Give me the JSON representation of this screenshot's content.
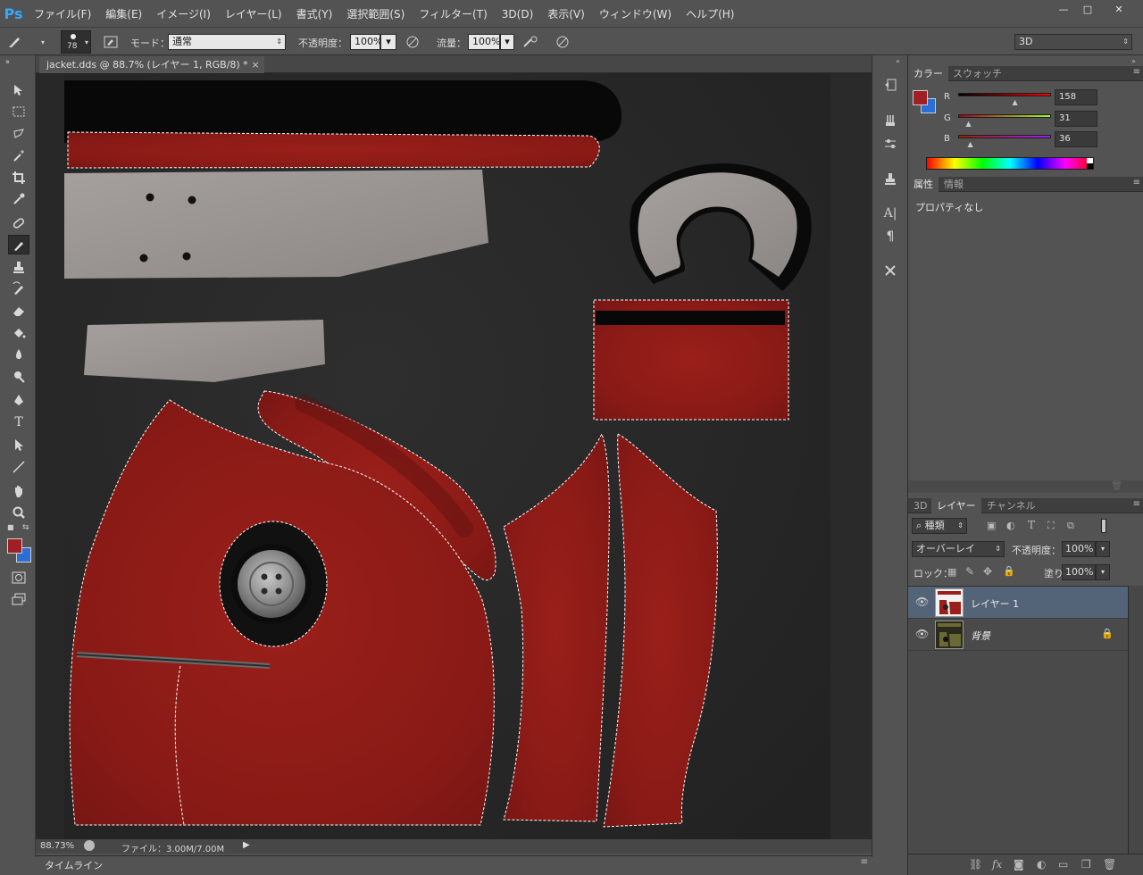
{
  "app": {
    "logo": "Ps"
  },
  "menu": [
    "ファイル(F)",
    "編集(E)",
    "イメージ(I)",
    "レイヤー(L)",
    "書式(Y)",
    "選択範囲(S)",
    "フィルター(T)",
    "3D(D)",
    "表示(V)",
    "ウィンドウ(W)",
    "ヘルプ(H)"
  ],
  "window_controls": {
    "minimize": "—",
    "maximize": "□",
    "close": "✕"
  },
  "options": {
    "brush_size": "78",
    "mode_label": "モード：",
    "mode_value": "通常",
    "opacity_label": "不透明度：",
    "opacity_value": "100%",
    "flow_label": "流量：",
    "flow_value": "100%",
    "workspace": "3D"
  },
  "document": {
    "tab_title": "jacket.dds @ 88.7% (レイヤー 1, RGB/8) *",
    "close": "×",
    "zoom": "88.73%",
    "file_info": "ファイル：3.00M/7.00M"
  },
  "timeline": {
    "label": "タイムライン"
  },
  "color_panel": {
    "tabs": [
      "カラー",
      "スウォッチ"
    ],
    "channels": [
      {
        "name": "R",
        "value": "158",
        "level": 0.62
      },
      {
        "name": "G",
        "value": "31",
        "level": 0.12
      },
      {
        "name": "B",
        "value": "36",
        "level": 0.14
      }
    ],
    "foreground": "#9e1f24",
    "background": "#2a6fd6"
  },
  "properties_panel": {
    "tabs": [
      "属性",
      "情報"
    ],
    "empty_text": "プロパティなし"
  },
  "layers_panel": {
    "tabs": [
      "3D",
      "レイヤー",
      "チャンネル"
    ],
    "filter_kind": "種類",
    "blend_mode": "オーバーレイ",
    "opacity_label": "不透明度：",
    "opacity_value": "100%",
    "lock_label": "ロック：",
    "fill_label": "塗り：",
    "fill_value": "100%",
    "layers": [
      {
        "name": "レイヤー 1",
        "selected": true
      },
      {
        "name": "背景",
        "selected": false,
        "locked": true
      }
    ],
    "bottom_icons": [
      "link-icon",
      "fx-icon",
      "mask-icon",
      "adjustment-icon",
      "group-icon",
      "new-layer-icon",
      "trash-icon"
    ]
  },
  "colors": {
    "jacket_red": "#8f1c18",
    "texture_bg": "#2a2a2a",
    "panel_bg": "#535353",
    "selected_layer": "#546478"
  }
}
